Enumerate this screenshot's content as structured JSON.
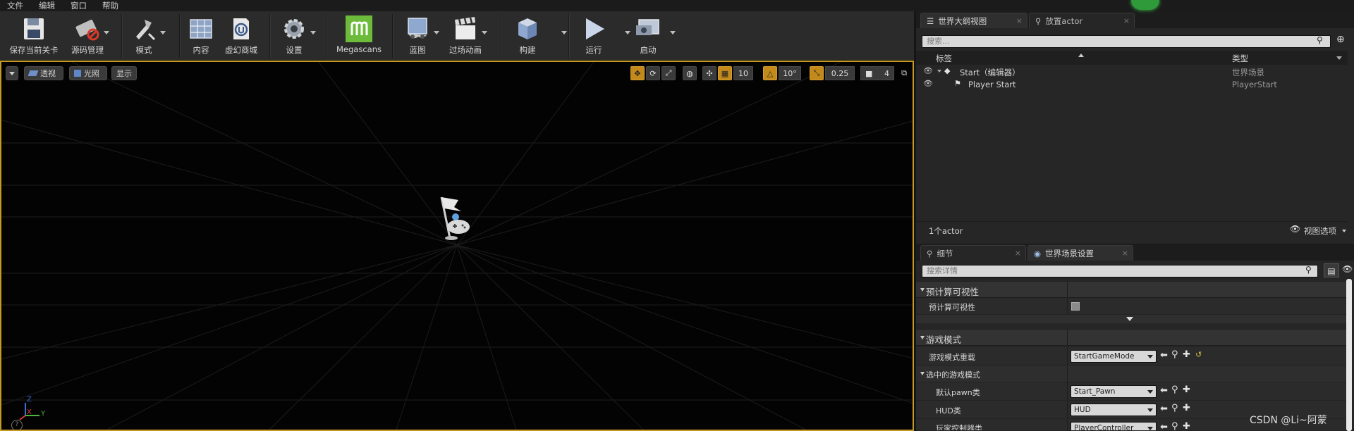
{
  "menu": [
    "文件",
    "编辑",
    "窗口",
    "帮助"
  ],
  "toolbar": {
    "save_current_level": "保存当前关卡",
    "source_control": "源码管理",
    "modes": "模式",
    "content": "内容",
    "marketplace": "虚幻商城",
    "settings": "设置",
    "megascans": "Megascans",
    "blueprints": "蓝图",
    "cinematics": "过场动画",
    "build": "构建",
    "play": "运行",
    "launch": "启动"
  },
  "viewport": {
    "perspective_label": "透视",
    "lit_label": "光照",
    "show_label": "显示",
    "grid_snap_value": "10",
    "rotation_snap_value": "10°",
    "scale_snap_value": "0.25",
    "camera_speed_value": "4",
    "axis_x": "X",
    "axis_y": "Y",
    "axis_z": "Z"
  },
  "outliner": {
    "tab_label": "世界大纲视图",
    "place_actor_tab": "放置actor",
    "search_placeholder": "搜索...",
    "col_label": "标签",
    "col_type": "类型",
    "rows": [
      {
        "label": "Start（编辑器）",
        "type": "世界场景"
      },
      {
        "label": "Player Start",
        "type": "PlayerStart"
      }
    ],
    "actor_count": "1个actor",
    "view_options": "视图选项"
  },
  "details": {
    "details_tab": "细节",
    "world_settings_tab": "世界场景设置",
    "search_placeholder": "搜索详情",
    "sections": {
      "precomputed_visibility": "预计算可视性",
      "game_mode": "游戏模式",
      "selected_game_mode": "选中的游戏模式"
    },
    "props": {
      "precomputed_visibility": "预计算可视性",
      "gamemode_override": "游戏模式重载",
      "default_pawn": "默认pawn类",
      "hud": "HUD类",
      "player_controller": "玩家控制器类"
    },
    "values": {
      "gamemode_override": "StartGameMode",
      "default_pawn": "Start_Pawn",
      "hud": "HUD",
      "player_controller": "PlayerController"
    }
  },
  "watermark": "CSDN @Li~阿蒙"
}
